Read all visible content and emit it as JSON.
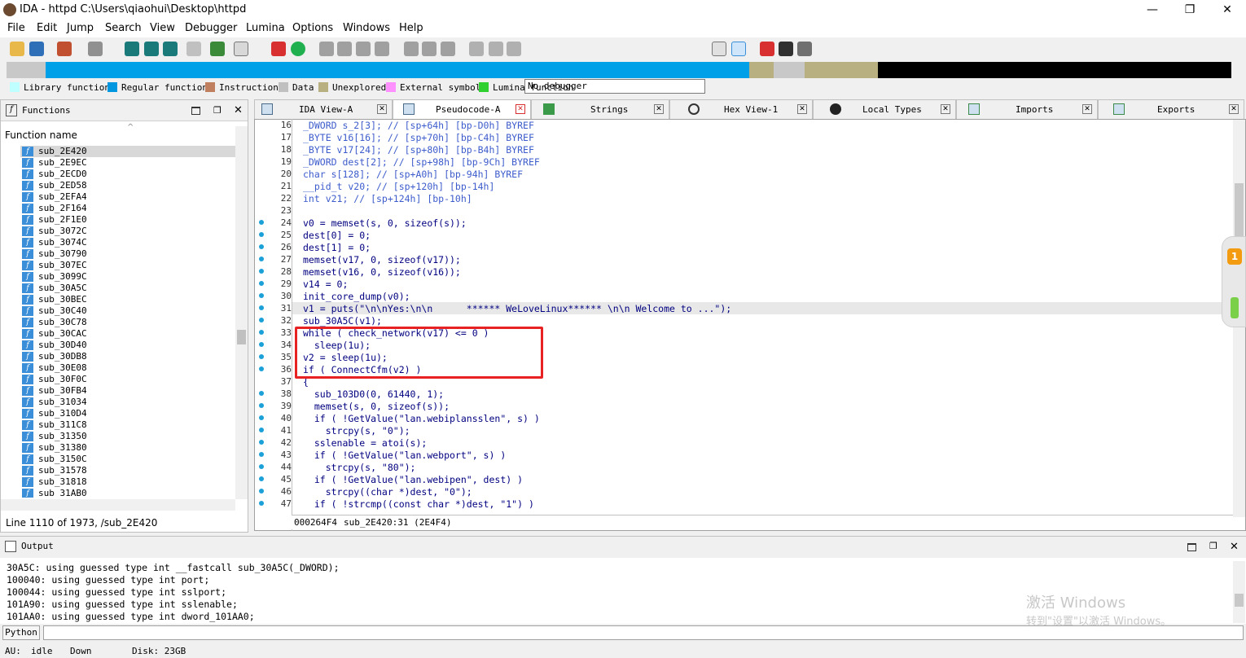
{
  "window": {
    "title": "IDA - httpd C:\\Users\\qiaohui\\Desktop\\httpd",
    "minimize": "—",
    "maximize": "❐",
    "close": "✕"
  },
  "menu": [
    "File",
    "Edit",
    "Jump",
    "Search",
    "View",
    "Debugger",
    "Lumina",
    "Options",
    "Windows",
    "Help"
  ],
  "toolbar": {
    "debugger_select": "No debugger"
  },
  "legend": [
    {
      "label": "Library function",
      "color": "#c0ffff"
    },
    {
      "label": "Regular function",
      "color": "#0096e0"
    },
    {
      "label": "Instruction",
      "color": "#c08060"
    },
    {
      "label": "Data",
      "color": "#c0c0c0"
    },
    {
      "label": "Unexplored",
      "color": "#b8b080"
    },
    {
      "label": "External symbol",
      "color": "#ff90ff"
    },
    {
      "label": "Lumina function",
      "color": "#30d030"
    }
  ],
  "functions_panel": {
    "title": "Functions",
    "column_header": "Function name",
    "items": [
      "sub_2E420",
      "sub_2E9EC",
      "sub_2ECD0",
      "sub_2ED58",
      "sub_2EFA4",
      "sub_2F164",
      "sub_2F1E0",
      "sub_3072C",
      "sub_3074C",
      "sub_30790",
      "sub_307EC",
      "sub_3099C",
      "sub_30A5C",
      "sub_30BEC",
      "sub_30C40",
      "sub_30C78",
      "sub_30CAC",
      "sub_30D40",
      "sub_30DB8",
      "sub_30E08",
      "sub_30F0C",
      "sub_30FB4",
      "sub_31034",
      "sub_310D4",
      "sub_311C8",
      "sub_31350",
      "sub_31380",
      "sub_3150C",
      "sub_31578",
      "sub_31818",
      "sub_31AB0"
    ],
    "status": "Line 1110 of 1973, /sub_2E420"
  },
  "tabs": [
    {
      "label": "IDA View-A"
    },
    {
      "label": "Pseudocode-A"
    },
    {
      "label": "Strings"
    },
    {
      "label": "Hex View-1"
    },
    {
      "label": "Local Types"
    },
    {
      "label": "Imports"
    },
    {
      "label": "Exports"
    }
  ],
  "code": {
    "line_numbers": [
      "16",
      "17",
      "18",
      "19",
      "20",
      "21",
      "22",
      "23",
      "24",
      "25",
      "26",
      "27",
      "28",
      "29",
      "30",
      "31",
      "32",
      "33",
      "34",
      "35",
      "36",
      "37",
      "38",
      "39",
      "40",
      "41",
      "42",
      "43",
      "44",
      "45",
      "46",
      "47"
    ],
    "lines": [
      "_DWORD s_2[3]; // [sp+64h] [bp-D0h] BYREF",
      "_BYTE v16[16]; // [sp+70h] [bp-C4h] BYREF",
      "_BYTE v17[24]; // [sp+80h] [bp-B4h] BYREF",
      "_DWORD dest[2]; // [sp+98h] [bp-9Ch] BYREF",
      "char s[128]; // [sp+A0h] [bp-94h] BYREF",
      "__pid_t v20; // [sp+120h] [bp-14h]",
      "int v21; // [sp+124h] [bp-10h]",
      "",
      "v0 = memset(s, 0, sizeof(s));",
      "dest[0] = 0;",
      "dest[1] = 0;",
      "memset(v17, 0, sizeof(v17));",
      "memset(v16, 0, sizeof(v16));",
      "v14 = 0;",
      "init_core_dump(v0);",
      "v1 = puts(\"\\n\\nYes:\\n\\n      ****** WeLoveLinux****** \\n\\n Welcome to ...\");",
      "sub_30A5C(v1);",
      "while ( check_network(v17) <= 0 )",
      "  sleep(1u);",
      "v2 = sleep(1u);",
      "if ( ConnectCfm(v2) )",
      "{",
      "  sub_103D0(0, 61440, 1);",
      "  memset(s, 0, sizeof(s));",
      "  if ( !GetValue(\"lan.webiplansslen\", s) )",
      "    strcpy(s, \"0\");",
      "  sslenable = atoi(s);",
      "  if ( !GetValue(\"lan.webport\", s) )",
      "    strcpy(s, \"80\");",
      "  if ( !GetValue(\"lan.webipen\", dest) )",
      "    strcpy((char *)dest, \"0\");",
      "  if ( !strcmp((const char *)dest, \"1\") )"
    ],
    "status_address": "000264F4",
    "status_location": "sub_2E420:31 (2E4F4)"
  },
  "output_panel": {
    "title": "Output",
    "lines": [
      "30A5C: using guessed type int __fastcall sub_30A5C(_DWORD);",
      "100040: using guessed type int port;",
      "100044: using guessed type int sslport;",
      "101A90: using guessed type int sslenable;",
      "101AA0: using guessed type int dword_101AA0;"
    ]
  },
  "python_button": "Python",
  "status": {
    "au_label": "AU:",
    "au_value": "idle",
    "direction": "Down",
    "disk": "Disk: 23GB"
  },
  "watermark": {
    "line1": "激活 Windows",
    "line2": "转到\"设置\"以激活 Windows。"
  }
}
